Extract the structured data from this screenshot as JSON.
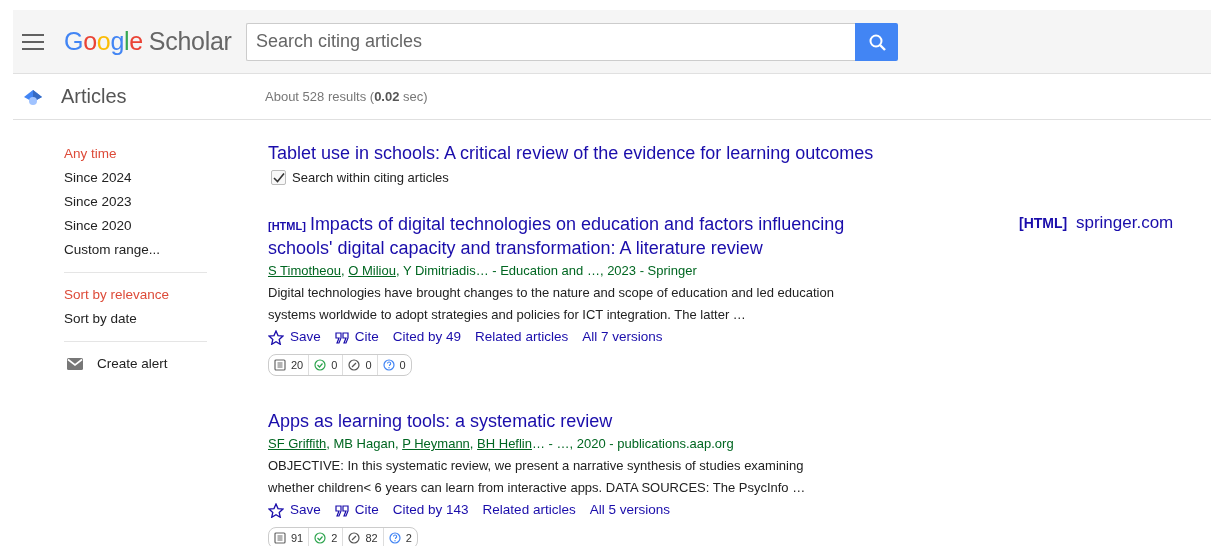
{
  "header": {
    "logo": {
      "brand": "Google",
      "product": "Scholar"
    },
    "search": {
      "placeholder": "Search citing articles"
    }
  },
  "subbar": {
    "section": "Articles",
    "summary": "About 528 results (**0.02** sec)"
  },
  "sidebar": {
    "time_filters": [
      {
        "label": "Any time",
        "selected": true
      },
      {
        "label": "Since 2024",
        "selected": false
      },
      {
        "label": "Since 2023",
        "selected": false
      },
      {
        "label": "Since 2020",
        "selected": false
      },
      {
        "label": "Custom range...",
        "selected": false
      }
    ],
    "sort": [
      {
        "label": "Sort by relevance",
        "selected": true
      },
      {
        "label": "Sort by date",
        "selected": false
      }
    ],
    "create_alert": "Create alert"
  },
  "cited_article": {
    "title": "Tablet use in schools: A critical review of the evidence for learning outcomes",
    "search_within": {
      "label": "Search within citing articles",
      "checked": true
    }
  },
  "results": [
    {
      "format_tag": "[HTML]",
      "title": "Impacts of digital technologies on education and factors influencing schools' digital capacity and transformation: A literature review",
      "byline": [
        {
          "text": "S Timotheou",
          "linked": true
        },
        {
          "text": ", ",
          "linked": false
        },
        {
          "text": "O Miliou",
          "linked": true
        },
        {
          "text": ", Y Dimitriadis… - Education and …, 2023 - Springer",
          "linked": false
        }
      ],
      "snippet": "Digital technologies have brought changes to the nature and scope of education and led education systems worldwide to adopt strategies and policies for ICT integration. The latter …",
      "actions": {
        "save": "Save",
        "cite": "Cite",
        "cited_by": "Cited by 49",
        "related": "Related articles",
        "versions": "All 7 versions"
      },
      "stats": [
        {
          "kind": "pages",
          "value": "20"
        },
        {
          "kind": "supporting",
          "value": "0"
        },
        {
          "kind": "mentioning",
          "value": "0"
        },
        {
          "kind": "unclassified",
          "value": "0"
        }
      ],
      "side_link": {
        "tag": "[HTML]",
        "text": "springer.com"
      }
    },
    {
      "title": "Apps as learning tools: a systematic review",
      "byline": [
        {
          "text": "SF Griffith",
          "linked": true
        },
        {
          "text": ", MB Hagan, ",
          "linked": false
        },
        {
          "text": "P Heymann",
          "linked": true
        },
        {
          "text": ", ",
          "linked": false
        },
        {
          "text": "BH Heflin",
          "linked": true
        },
        {
          "text": "… - …, 2020 - publications.aap.org",
          "linked": false
        }
      ],
      "snippet": "OBJECTIVE: In this systematic review, we present a narrative synthesis of studies examining whether children< 6 years can learn from interactive apps. DATA SOURCES: The PsycInfo …",
      "actions": {
        "save": "Save",
        "cite": "Cite",
        "cited_by": "Cited by 143",
        "related": "Related articles",
        "versions": "All 5 versions"
      },
      "stats": [
        {
          "kind": "pages",
          "value": "91"
        },
        {
          "kind": "supporting",
          "value": "2"
        },
        {
          "kind": "mentioning",
          "value": "82"
        },
        {
          "kind": "unclassified",
          "value": "2"
        }
      ]
    }
  ]
}
